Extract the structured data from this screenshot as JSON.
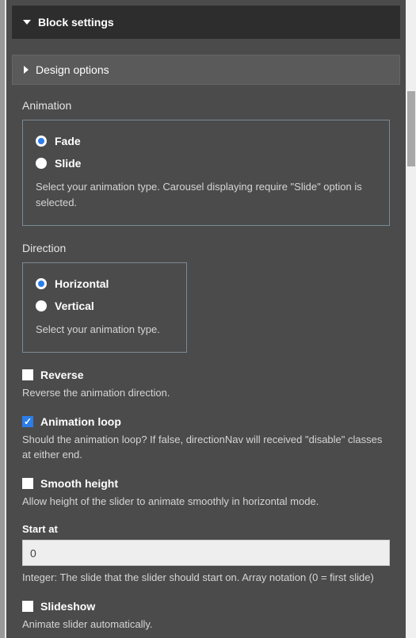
{
  "header": {
    "title": "Block settings"
  },
  "subheader": {
    "title": "Design options"
  },
  "animation": {
    "label": "Animation",
    "options": {
      "fade": "Fade",
      "slide": "Slide"
    },
    "help": "Select your animation type. Carousel displaying require \"Slide\" option is selected."
  },
  "direction": {
    "label": "Direction",
    "options": {
      "horizontal": "Horizontal",
      "vertical": "Vertical"
    },
    "help": "Select your animation type."
  },
  "reverse": {
    "label": "Reverse",
    "descr": "Reverse the animation direction."
  },
  "loop": {
    "label": "Animation loop",
    "descr": "Should the animation loop? If false, directionNav will received \"disable\" classes at either end."
  },
  "smooth": {
    "label": "Smooth height",
    "descr": "Allow height of the slider to animate smoothly in horizontal mode."
  },
  "startat": {
    "label": "Start at",
    "value": "0",
    "descr": "Integer: The slide that the slider should start on. Array notation (0 = first slide)"
  },
  "slideshow": {
    "label": "Slideshow",
    "descr": "Animate slider automatically."
  }
}
